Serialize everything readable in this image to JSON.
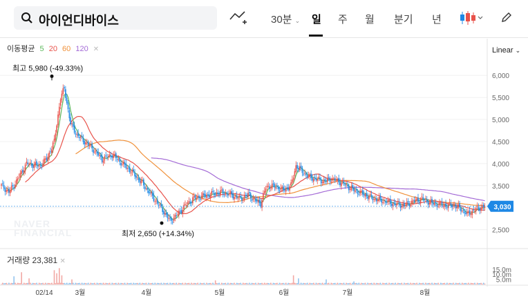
{
  "search": {
    "query": "아이언디바이스"
  },
  "toolbar": {
    "periods": [
      "30분",
      "일",
      "주",
      "월",
      "분기",
      "년"
    ],
    "active_period": "일"
  },
  "legend": {
    "ma_title": "이동평균",
    "ma_periods": [
      {
        "label": "5",
        "color": "#5cb85c"
      },
      {
        "label": "20",
        "color": "#e8524a"
      },
      {
        "label": "60",
        "color": "#f0913a"
      },
      {
        "label": "120",
        "color": "#a36ad6"
      }
    ],
    "volume_label": "거래량 23,381",
    "scale": "Linear"
  },
  "watermark": [
    "NAVER",
    "FINANCIAL"
  ],
  "colors": {
    "up": "#e8524a",
    "down": "#1e88e5",
    "vol_up": "#f2a8a4",
    "vol_down": "#93c4ee"
  },
  "chart_data": {
    "type": "candlestick",
    "y_ticks": [
      6000,
      5500,
      5000,
      4500,
      4000,
      3500,
      3000,
      2500
    ],
    "y_tick_labels": [
      "6,000",
      "5,500",
      "5,000",
      "4,500",
      "4,000",
      "3,500",
      "3,000",
      "2,500"
    ],
    "ylim": [
      2150,
      6300
    ],
    "x_labels": [
      "02/14",
      "3월",
      "4월",
      "5월",
      "6월",
      "7월",
      "8월"
    ],
    "current_price": "3,030",
    "current_value": 3030,
    "high_annotation": "최고 5,980 (-49.33%)",
    "high_value": 5980,
    "low_annotation": "최저 2,650 (+14.34%)",
    "low_value": 2650,
    "volume_ticks": [
      "15.0m",
      "10.0m",
      "5.0m"
    ],
    "volume_tick_values": [
      15000000,
      10000000,
      5000000
    ],
    "volume_max": 25000000,
    "close_anchors": [
      [
        0,
        3500
      ],
      [
        6,
        3350
      ],
      [
        12,
        3600
      ],
      [
        20,
        4000
      ],
      [
        30,
        3950
      ],
      [
        36,
        4100
      ],
      [
        42,
        4500
      ],
      [
        47,
        5500
      ],
      [
        50,
        5700
      ],
      [
        55,
        4900
      ],
      [
        60,
        4650
      ],
      [
        66,
        4500
      ],
      [
        72,
        4350
      ],
      [
        80,
        4100
      ],
      [
        88,
        4200
      ],
      [
        96,
        4000
      ],
      [
        104,
        3800
      ],
      [
        112,
        3550
      ],
      [
        120,
        3250
      ],
      [
        128,
        2950
      ],
      [
        134,
        2700
      ],
      [
        140,
        2850
      ],
      [
        146,
        3050
      ],
      [
        152,
        3200
      ],
      [
        158,
        3250
      ],
      [
        166,
        3300
      ],
      [
        174,
        3350
      ],
      [
        182,
        3300
      ],
      [
        190,
        3200
      ],
      [
        196,
        3300
      ],
      [
        202,
        3150
      ],
      [
        206,
        3100
      ],
      [
        210,
        3450
      ],
      [
        214,
        3500
      ],
      [
        220,
        3450
      ],
      [
        224,
        3400
      ],
      [
        230,
        3500
      ],
      [
        234,
        3950
      ],
      [
        238,
        3850
      ],
      [
        244,
        3700
      ],
      [
        250,
        3650
      ],
      [
        256,
        3600
      ],
      [
        262,
        3650
      ],
      [
        268,
        3600
      ],
      [
        274,
        3500
      ],
      [
        280,
        3400
      ],
      [
        288,
        3300
      ],
      [
        296,
        3200
      ],
      [
        304,
        3150
      ],
      [
        310,
        3100
      ],
      [
        320,
        3050
      ],
      [
        328,
        3150
      ],
      [
        334,
        3200
      ],
      [
        342,
        3100
      ],
      [
        352,
        3050
      ],
      [
        360,
        3050
      ],
      [
        366,
        2950
      ],
      [
        370,
        2850
      ],
      [
        376,
        2950
      ],
      [
        380,
        3000
      ],
      [
        384,
        3030
      ]
    ],
    "volume_spikes": [
      [
        10,
        8000000
      ],
      [
        16,
        12000000
      ],
      [
        22,
        6000000
      ],
      [
        42,
        14000000
      ],
      [
        44,
        11000000
      ],
      [
        46,
        16000000
      ],
      [
        48,
        9000000
      ],
      [
        56,
        5000000
      ],
      [
        170,
        4000000
      ],
      [
        232,
        9000000
      ],
      [
        236,
        6000000
      ],
      [
        258,
        5000000
      ],
      [
        280,
        3000000
      ]
    ]
  }
}
